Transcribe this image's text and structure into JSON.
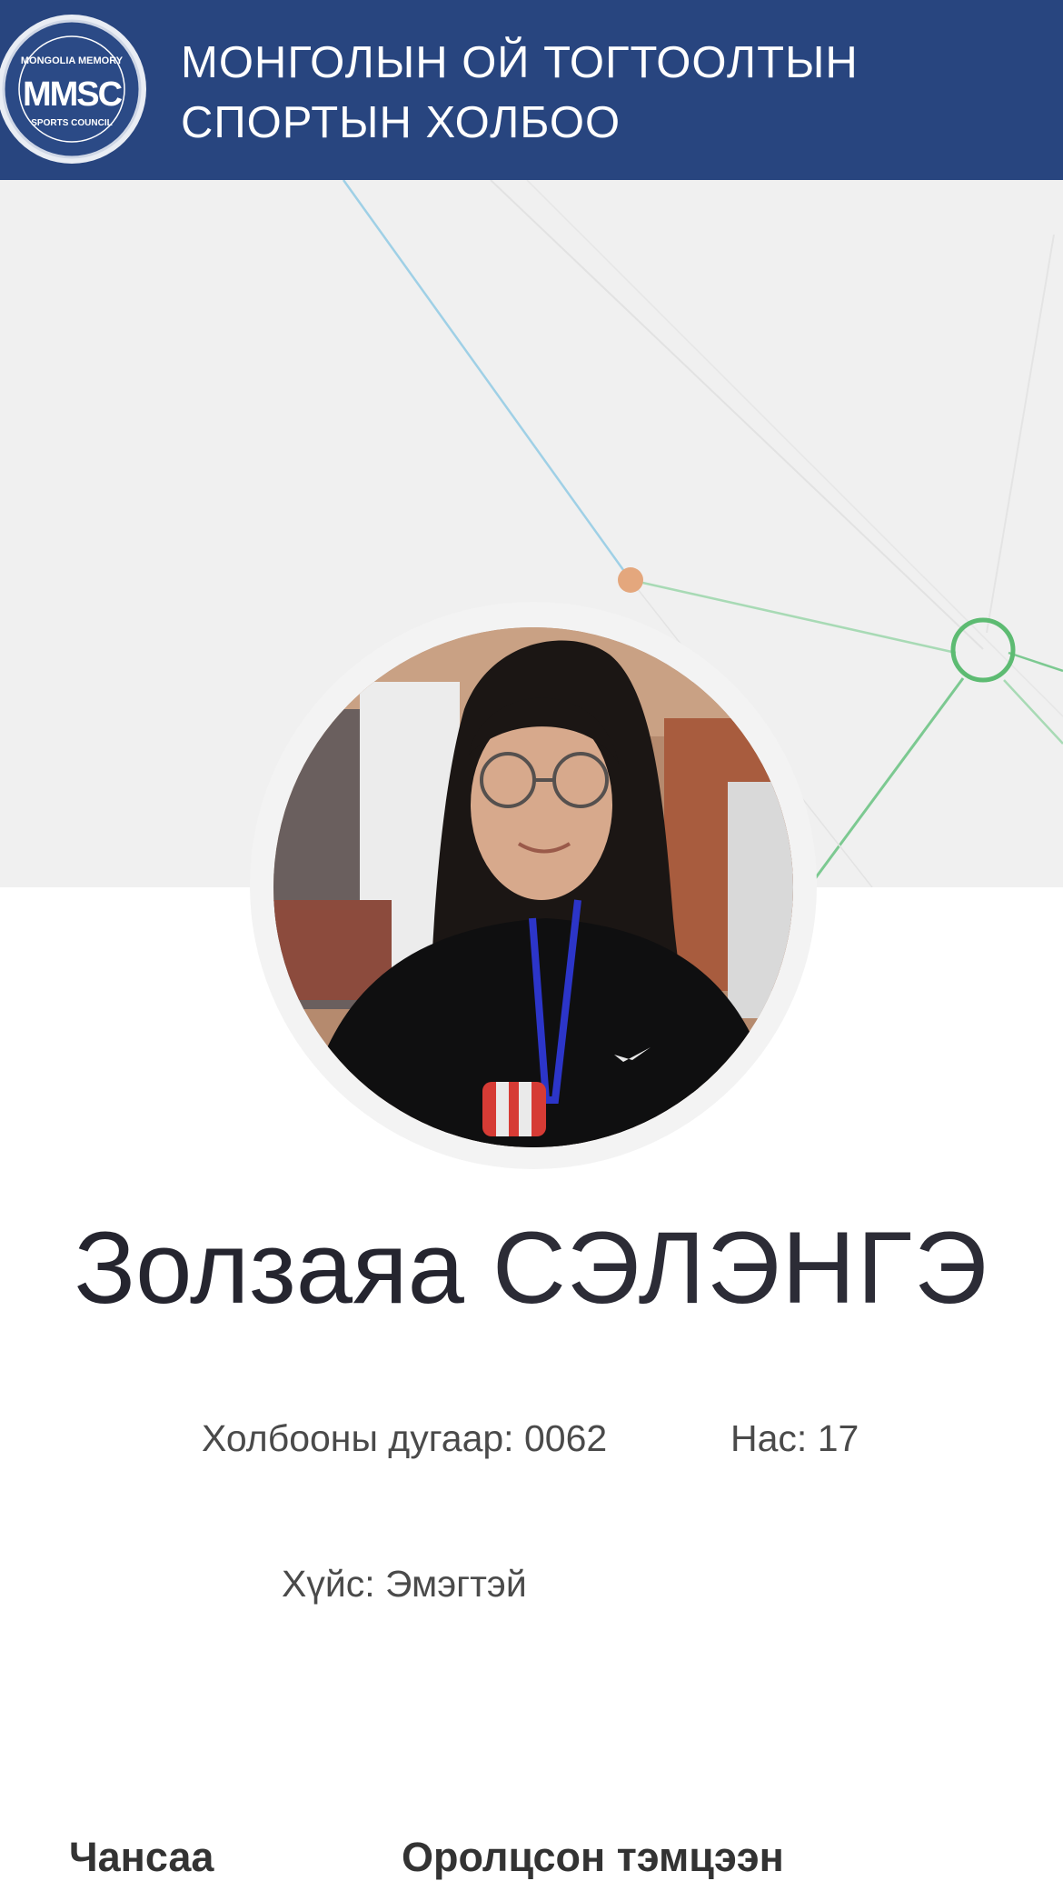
{
  "header": {
    "logo_text": "MMSC",
    "logo_ring_top": "MONGOLIA MEMORY",
    "logo_ring_bottom": "SPORTS COUNCIL",
    "title_line1": "МОНГОЛЫН ОЙ ТОГТООЛТЫН",
    "title_line2": "СПОРТЫН ХОЛБОО"
  },
  "profile": {
    "first_name": "Золзаяа",
    "last_name": "СЭЛЭНГЭ",
    "member_number_label": "Холбооны дугаар:",
    "member_number": "0062",
    "age_label": "Нас:",
    "age": "17",
    "gender_label": "Хүйс:",
    "gender": "Эмэгтэй"
  },
  "sections": {
    "rank_heading": "Чансаа",
    "competitions_heading": "Оролцсон тэмцээн"
  },
  "colors": {
    "header_bg": "#28457f",
    "cover_bg": "#f0f0f0",
    "node_orange": "#e4a77d",
    "node_green": "#5dbb72",
    "line_blue": "#9fd0e6"
  }
}
